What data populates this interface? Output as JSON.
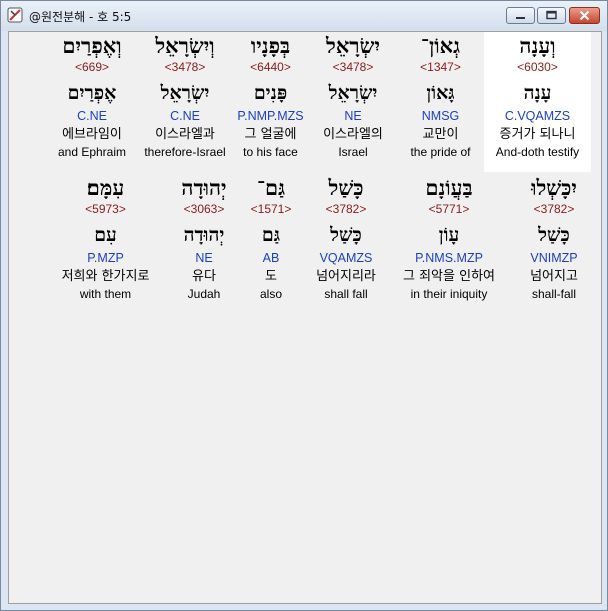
{
  "window": {
    "title": "@원전분해 - 호 5:5",
    "buttons": {
      "minimize": "minimize",
      "maximize": "maximize",
      "close": "close"
    },
    "colors": {
      "strong": "#8b1a1a",
      "morph": "#1a3fc4",
      "selected": "#ffffff"
    }
  },
  "rows": [
    {
      "cells": [
        {
          "hebrew": "וְעָנָה",
          "strong": "<6030>",
          "lemma": "עָנָה",
          "morph": "C.VQAMZS",
          "korean": "증거가 되나니",
          "english": "And-doth testify",
          "selected": true
        },
        {
          "hebrew": "גְאוֹן־",
          "strong": "<1347>",
          "lemma": "גָּאוֹן",
          "morph": "NMSG",
          "korean": "교만이",
          "english": "the pride of"
        },
        {
          "hebrew": "יִשְׂרָאֵל",
          "strong": "<3478>",
          "lemma": "יִשְׂרָאֵל",
          "morph": "NE",
          "korean": "이스라엘의",
          "english": "Israel"
        },
        {
          "hebrew": "בְּפָנָיו",
          "strong": "<6440>",
          "lemma": "פָּנִים",
          "morph": "P.NMP.MZS",
          "korean": "그 얼굴에",
          "english": "to his face"
        },
        {
          "hebrew": "וְיִשְׂרָאֵל",
          "strong": "<3478>",
          "lemma": "יִשְׂרָאֵל",
          "morph": "C.NE",
          "korean": "이스라엘과",
          "english": "therefore-Israel"
        },
        {
          "hebrew": "וְאֶפְרַיִם",
          "strong": "<669>",
          "lemma": "אֶפְרַיִם",
          "morph": "C.NE",
          "korean": "에브라임이",
          "english": "and Ephraim"
        }
      ]
    },
    {
      "cells": [
        {
          "hebrew": "יִכָּשְׁלוּ",
          "strong": "<3782>",
          "lemma": "כָּשַׁל",
          "morph": "VNIMZP",
          "korean": "넘어지고",
          "english": "shall-fall"
        },
        {
          "hebrew": "בַּעֲוֹנָם",
          "strong": "<5771>",
          "lemma": "עָוֹן",
          "morph": "P.NMS.MZP",
          "korean": "그 죄악을 인하여",
          "english": "in their iniquity"
        },
        {
          "hebrew": "כָּשַׁל",
          "strong": "<3782>",
          "lemma": "כָּשַׁל",
          "morph": "VQAMZS",
          "korean": "넘어지리라",
          "english": "shall fall"
        },
        {
          "hebrew": "גַּם־",
          "strong": "<1571>",
          "lemma": "גַּם",
          "morph": "AB",
          "korean": "도",
          "english": "also"
        },
        {
          "hebrew": "יְהוּדָה",
          "strong": "<3063>",
          "lemma": "יְהוּדָה",
          "morph": "NE",
          "korean": "유다",
          "english": "Judah"
        },
        {
          "hebrew": "עִמָּם׃",
          "strong": "<5973>",
          "lemma": "עִם",
          "morph": "P.MZP",
          "korean": "저희와 한가지로",
          "english": "with them"
        }
      ]
    }
  ]
}
